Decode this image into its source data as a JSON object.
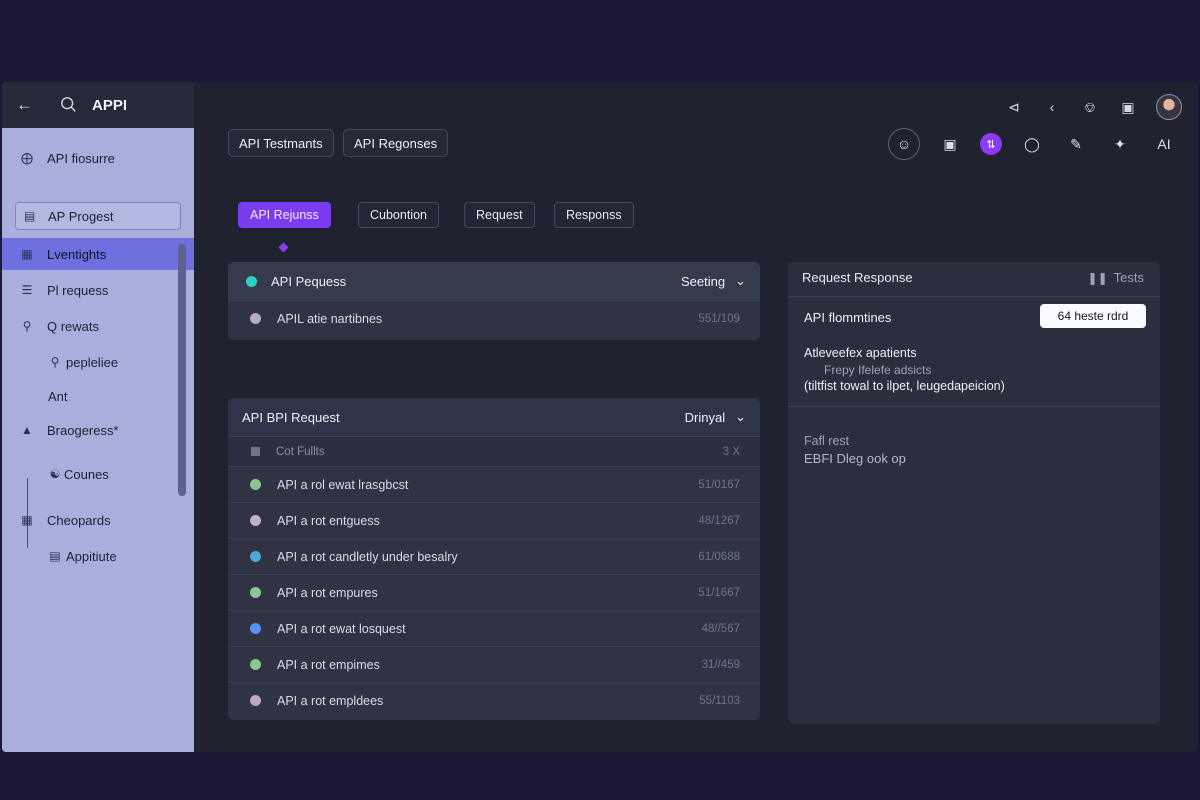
{
  "sidebar": {
    "title": "APPI",
    "items": [
      {
        "label": "API fiosurre",
        "icon": "eye-icon"
      },
      {
        "label": "AP Progest",
        "icon": "document-icon"
      },
      {
        "label": "Lventights",
        "icon": "grid-icon"
      },
      {
        "label": "Pl requess",
        "icon": "menu-icon"
      },
      {
        "label": "Q rewats",
        "icon": "pin-icon"
      },
      {
        "label": "pepleliee",
        "icon": "search-icon"
      },
      {
        "label": "Ant",
        "icon": ""
      },
      {
        "label": "Braogeress*",
        "icon": "arrow-up-icon"
      },
      {
        "label": "Counes",
        "icon": "users-icon"
      },
      {
        "label": "Cheopards",
        "icon": "grid-icon"
      },
      {
        "label": "Appitiute",
        "icon": "document-icon"
      }
    ]
  },
  "header": {
    "chips": [
      "API Testmants",
      "API Regonses"
    ],
    "toolbar_label_ai": "AI"
  },
  "tabs": [
    {
      "label": "API Rejunss",
      "active": true
    },
    {
      "label": "Cubontion",
      "active": false
    },
    {
      "label": "Request",
      "active": false
    },
    {
      "label": "Responss",
      "active": false
    }
  ],
  "panel1": {
    "title": "API Pequess",
    "dropdown": "Seeting",
    "rows": [
      {
        "label": "APIL atie nartibnes",
        "num": "551/109",
        "color": "#b9a9c8"
      }
    ]
  },
  "panel2": {
    "title": "API BPI Request",
    "dropdown": "Drinyal",
    "sub": {
      "label": "Cot Fullts",
      "num": "3 X"
    },
    "rows": [
      {
        "label": "API a rol ewat lrasgbcst",
        "num": "51/0167",
        "color": "#86c890"
      },
      {
        "label": "API a rot entguess",
        "num": "48/1267",
        "color": "#c0b0cc"
      },
      {
        "label": "API a rot candletly under besalry",
        "num": "61/0688",
        "color": "#4fa8d8"
      },
      {
        "label": "API a rot empures",
        "num": "51/1667",
        "color": "#8ac898"
      },
      {
        "label": "API a rot ewat losquest",
        "num": "48//567",
        "color": "#5b8ff0"
      },
      {
        "label": "API a rot empimes",
        "num": "31//459",
        "color": "#86c890"
      },
      {
        "label": "API a rot empldees",
        "num": "55/1103",
        "color": "#b9a9c8"
      }
    ]
  },
  "response": {
    "title": "Request Response",
    "tests_label": "Tests",
    "row_label": "API flommtines",
    "badge": "64 heste rdrd",
    "desc_title": "Atleveefex apatients",
    "desc_sub": "Frepy Ifelefe adsicts",
    "desc_line": "(tiltfist towal to ilpet, leugedapeicion)",
    "footer_title": "Fafl rest",
    "footer_line": "EBFI Dleg ook op"
  }
}
